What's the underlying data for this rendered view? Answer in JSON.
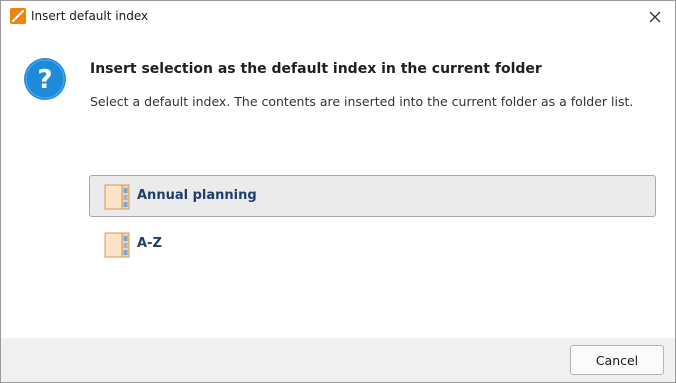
{
  "window": {
    "title": "Insert default index"
  },
  "dialog": {
    "heading": "Insert selection as the default index in the current folder",
    "description": "Select a default index. The contents are inserted into the current folder as a folder list."
  },
  "indexes": [
    {
      "label": "Annual planning",
      "selected": true,
      "icon": "folder-index-icon"
    },
    {
      "label": "A-Z",
      "selected": false,
      "icon": "folder-index-icon"
    }
  ],
  "footer": {
    "cancel_label": "Cancel"
  },
  "colors": {
    "accent": "#f08300",
    "question_icon": "#1f8ad9",
    "item_label": "#1e3f6e"
  }
}
